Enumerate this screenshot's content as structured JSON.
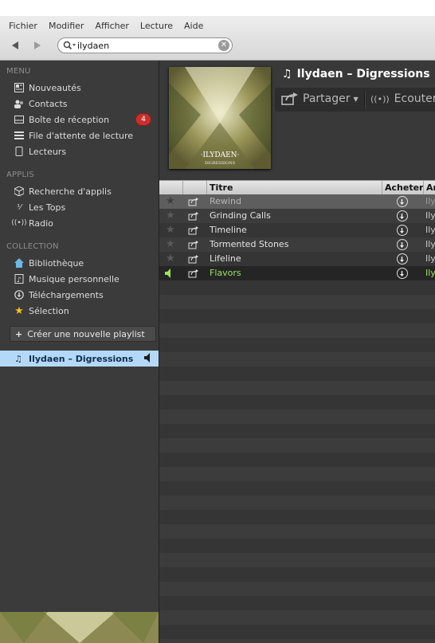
{
  "menubar": [
    "Fichier",
    "Modifier",
    "Afficher",
    "Lecture",
    "Aide"
  ],
  "search": {
    "value": "ilydaen",
    "placeholder": ""
  },
  "sidebar": {
    "menu_heading": "MENU",
    "menu_items": [
      {
        "label": "Nouveautés",
        "icon": "news-icon"
      },
      {
        "label": "Contacts",
        "icon": "people-icon"
      },
      {
        "label": "Boîte de réception",
        "icon": "inbox-icon",
        "badge": "4"
      },
      {
        "label": "File d'attente de lecture",
        "icon": "queue-icon"
      },
      {
        "label": "Lecteurs",
        "icon": "devices-icon"
      }
    ],
    "apps_heading": "APPLIS",
    "apps_items": [
      {
        "label": "Recherche d'applis",
        "icon": "app-finder-icon"
      },
      {
        "label": "Les Tops",
        "icon": "top-lists-icon"
      },
      {
        "label": "Radio",
        "icon": "radio-icon"
      }
    ],
    "collection_heading": "COLLECTION",
    "collection_items": [
      {
        "label": "Bibliothèque",
        "icon": "library-icon"
      },
      {
        "label": "Musique personnelle",
        "icon": "local-music-icon"
      },
      {
        "label": "Téléchargements",
        "icon": "downloads-icon"
      },
      {
        "label": "Sélection",
        "icon": "starred-icon"
      }
    ],
    "new_playlist": "Créer une nouvelle playlist",
    "current_playlist": "Ilydaen – Digressions"
  },
  "album": {
    "title": "Ilydaen – Digressions",
    "share_label": "Partager",
    "listen_label": "Ecouter",
    "cover_text": "·ILYDAEN·",
    "cover_subtext": "DIGRESSIONS"
  },
  "table": {
    "headers": {
      "title": "Titre",
      "buy": "Acheter",
      "artist": "Ar"
    },
    "tracks": [
      {
        "title": "Rewind",
        "artist": "Ily",
        "state": "selected"
      },
      {
        "title": "Grinding Calls",
        "artist": "Ily",
        "state": "normal"
      },
      {
        "title": "Timeline",
        "artist": "Ily",
        "state": "normal"
      },
      {
        "title": "Tormented Stones",
        "artist": "Ily",
        "state": "normal"
      },
      {
        "title": "Lifeline",
        "artist": "Ily",
        "state": "normal"
      },
      {
        "title": "Flavors",
        "artist": "Ily",
        "state": "playing"
      }
    ]
  },
  "colors": {
    "playing": "#9be35a",
    "badge": "#c8302c",
    "selection": "#b4d9f8"
  }
}
